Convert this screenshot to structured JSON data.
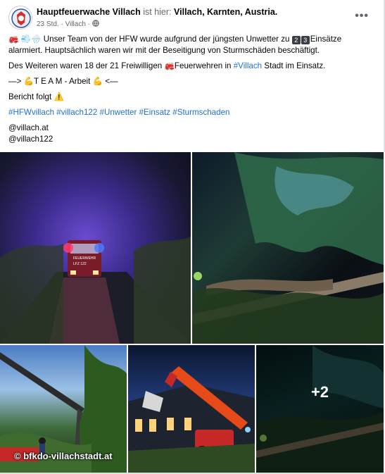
{
  "post": {
    "page_name": "Hauptfeuerwache Villach",
    "is_here": "ist hier:",
    "location": "Villach, Karnten, Austria.",
    "time": "23 Std.",
    "place": "Villach",
    "separator": "·",
    "menu_icon": "more-options-icon",
    "text": {
      "line1_emoji": "🚒 💨🌧️",
      "line1_text": "Unser Team von der HFW wurde aufgrund der jüngsten Unwetter zu",
      "badge1": "2",
      "badge2": "3",
      "line1_end": "Einsätze alarmiert. Hauptsächlich waren wir mit der Beseitigung von Sturmschäden beschäftigt.",
      "line2_start": "Des Weiteren waren 18 der 21 Freiwilligen",
      "line2_emoji": "🚒",
      "line2_mid": "Feuerwehren in",
      "line2_link": "#Villach",
      "line2_end": "Stadt im Einsatz.",
      "line3": "—> 💪T E A M - Arbeit 💪 <—",
      "line4": "Bericht folgt ⚠️",
      "hashtags": "#HFWvillach #villach122 #Unwetter #Einsatz #Sturmschaden",
      "handle1": "@villach.at",
      "handle2": "@villach122"
    }
  },
  "media": {
    "more_count": "+2",
    "watermark": "© bfkdo-villachstadt.at",
    "photo_labels": [
      "FEUERWEHR",
      "LFZ 122"
    ]
  }
}
